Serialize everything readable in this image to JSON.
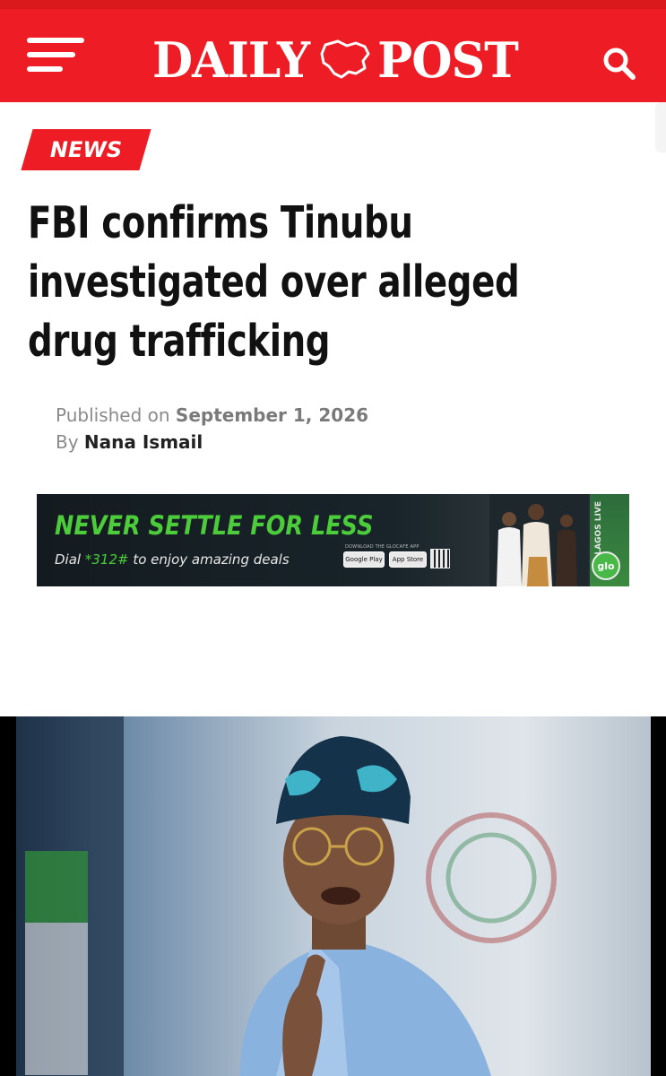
{
  "header": {
    "logo_left": "DAILY",
    "logo_right": "POST",
    "logo_icon": "nigeria-map-outline",
    "menu_icon": "hamburger-menu-icon",
    "search_icon": "search-icon",
    "brand_color": "#ee1c25"
  },
  "article": {
    "category": "NEWS",
    "title": "FBI confirms Tinubu investigated over alleged drug trafficking",
    "title_lines": [
      "FBI confirms Tinubu",
      "investigated over alleged",
      "drug trafficking"
    ],
    "published_prefix": "Published on",
    "published_date": "September 1, 2026",
    "by_prefix": "By",
    "author": "Nana Ismail"
  },
  "ad": {
    "headline": "NEVER SETTLE FOR LESS",
    "sub_prefix": "Dial",
    "sub_code": "*312#",
    "sub_suffix": "to enjoy amazing deals",
    "store_caption": "DOWNLOAD THE GLOCAFE APP",
    "store_google": "Google Play",
    "store_apple": "App Store",
    "side_text": "LAGOS LIVE",
    "brand": "glo",
    "accent_color": "#4ccb3b"
  },
  "photo": {
    "subject": "man in blue cap and glasses pointing finger"
  }
}
